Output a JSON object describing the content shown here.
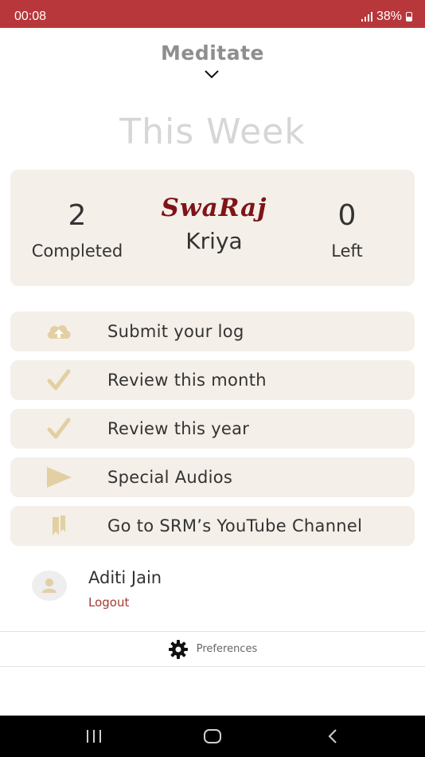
{
  "status_bar": {
    "time": "00:08",
    "battery_text": "38%"
  },
  "header": {
    "title": "Meditate"
  },
  "week": {
    "title": "This Week"
  },
  "stats": {
    "completed_value": "2",
    "completed_label": "Completed",
    "left_value": "0",
    "left_label": "Left",
    "brand_logo": "SwaRaj",
    "brand_subtitle": "Kriya"
  },
  "menu": {
    "items": [
      {
        "label": "Submit your log",
        "icon": "cloud-upload-icon"
      },
      {
        "label": "Review this month",
        "icon": "checkmark-icon"
      },
      {
        "label": "Review this year",
        "icon": "checkmark-icon"
      },
      {
        "label": "Special Audios",
        "icon": "play-icon"
      },
      {
        "label": "Go to SRM’s YouTube Channel",
        "icon": "bookmark-icon"
      }
    ]
  },
  "user": {
    "name": "Aditi Jain",
    "logout_label": "Logout"
  },
  "preferences": {
    "label": "Preferences"
  },
  "colors": {
    "status_bar": "#b8373a",
    "card_bg": "#f4efe8",
    "icon_tan": "#e2cfa4",
    "brand_red": "#7e1418",
    "logout_red": "#a33a36"
  }
}
